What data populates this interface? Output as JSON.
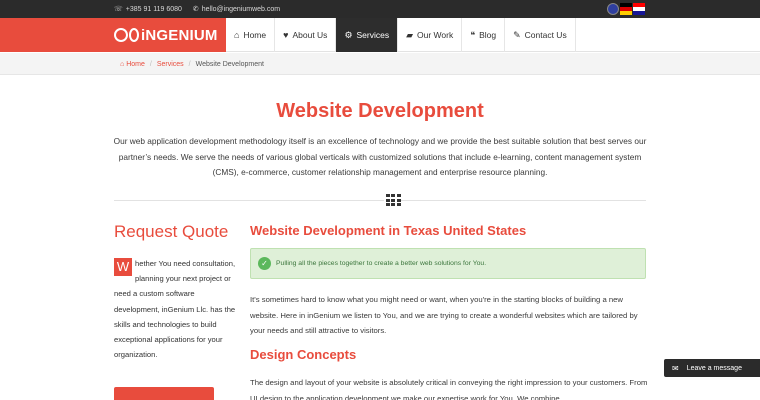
{
  "topbar": {
    "phone": "+385 91 119 6080",
    "email": "hello@ingeniumweb.com"
  },
  "logo": {
    "text": "iNGENIUM"
  },
  "nav": {
    "items": [
      {
        "label": "Home",
        "icon": "home-icon"
      },
      {
        "label": "About Us",
        "icon": "heart-icon"
      },
      {
        "label": "Services",
        "icon": "gears-icon",
        "active": true
      },
      {
        "label": "Our Work",
        "icon": "briefcase-icon"
      },
      {
        "label": "Blog",
        "icon": "comments-icon"
      },
      {
        "label": "Contact Us",
        "icon": "edit-icon"
      }
    ]
  },
  "breadcrumb": {
    "home": "Home",
    "services": "Services",
    "current": "Website Development"
  },
  "page": {
    "title": "Website Development",
    "intro": "Our web application development methodology itself is an excellence of technology and we provide the best suitable solution that best serves our partner’s needs. We serve the needs of various global verticals with customized solutions that include e-learning, content management system (CMS), e-commerce, customer relationship management and enterprise resource planning."
  },
  "sidebar": {
    "title": "Request Quote",
    "dropcap": "W",
    "text": "hether You need consultation, planning your next project or need a custom software development, inGenium Llc. has the skills and technologies to build exceptional applications for your organization."
  },
  "main": {
    "heading": "Website Development in Texas United States",
    "alert": "Pulling all the pieces together to create a better web solutions for You.",
    "paragraph1": "It's sometimes hard to know what you might need or want, when you're in the starting blocks of building a new website. Here in inGenium we listen to You, and we are trying to create a wonderful websites which are tailored by your needs and still attractive to visitors.",
    "subheading": "Design Concepts",
    "paragraph2": "The design and layout of your website is absolutely critical in conveying the right impression to your customers. From UI design to the application development we make our expertise work for You. We combine"
  },
  "chat": {
    "label": "Leave a message"
  },
  "colors": {
    "accent": "#e84c3d",
    "dark": "#2d2d2d",
    "success_bg": "#dff0d8"
  }
}
